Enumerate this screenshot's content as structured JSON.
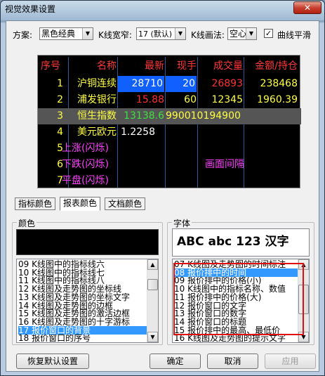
{
  "window": {
    "title": "视觉效果设置",
    "close_glyph": "✕"
  },
  "toolbar": {
    "scheme_label": "方案:",
    "scheme_value": "黑色经典",
    "kline_width_label": "K线宽窄:",
    "kline_width_value": "17 (默认)",
    "kline_draw_label": "K线画法:",
    "kline_draw_value": "空心",
    "smooth_label": "曲线平滑",
    "smooth_checked": "✓"
  },
  "preview": {
    "headers": [
      "序号",
      "名称",
      "最新",
      "现手",
      "成交量",
      "金额/持仓"
    ],
    "rows": [
      {
        "no": "1",
        "name": "沪铜连续",
        "latest": "28710",
        "hand": "20",
        "volume": "26893",
        "amount": "238468"
      },
      {
        "no": "2",
        "name": "浦发银行",
        "latest": "15.88",
        "hand": "60",
        "volume": "12345",
        "amount": "1960.39"
      },
      {
        "no": "3",
        "name": "恒生指数",
        "latest": "13138.6",
        "hand": "990010194900",
        "volume": "",
        "amount": ""
      },
      {
        "no": "4",
        "name": "美元欧元",
        "latest": "1.2258",
        "hand": "",
        "volume": "",
        "amount": ""
      },
      {
        "no": "5",
        "name": "上涨(闪烁)",
        "latest": "",
        "hand": "",
        "volume": "",
        "amount": ""
      },
      {
        "no": "6",
        "name": "下跌(闪烁)",
        "latest": "",
        "hand": "画面间隔",
        "volume": "",
        "amount": ""
      },
      {
        "no": "7",
        "name": "平盘(闪烁)",
        "latest": "",
        "hand": "",
        "volume": "",
        "amount": ""
      }
    ]
  },
  "tabs": [
    "指标颜色",
    "报表颜色",
    "文档颜色"
  ],
  "color_group": {
    "title": "颜色",
    "items": [
      "09 K线图中的指标线六",
      "10 K线图中的指标线七",
      "11 K线图中的指标线八",
      "12 K线图及走势图的坐标线",
      "13 K线图及走势图的坐标文字",
      "14 K线图及走势图的边框",
      "15 K线图及走势图的激活边框",
      "16 K线图及走势图的十字游标",
      "17 报价窗口的背景",
      "18 报价窗口的序号"
    ],
    "selected_index": 8
  },
  "font_group": {
    "title": "字体",
    "sample": "ABC abc 123 汉字",
    "items": [
      "07 K线图及走势图的时间标注",
      "08 报价排中的时间",
      "09 报价排中的价格(小)",
      "10 K线图中的指标名称、数值",
      "11 报价排中的价格(大)",
      "12 报价窗口的文字",
      "13 报价窗口的数字",
      "14 报价窗口的标题",
      "15 报价排中的最高、最低价",
      "16 K线图及走势图的提示文字"
    ],
    "selected_index": 1
  },
  "buttons": {
    "restore": "恢复默认设置",
    "ok": "确定",
    "cancel": "取消",
    "apply": "应用"
  },
  "colors": {
    "header_text": "#ff3838",
    "row_no": "#ffff40",
    "name_yellow": "#ffff40",
    "up_red": "#ff3030",
    "down_green": "#40e040",
    "white": "#ffffff",
    "magenta": "#ff40ff",
    "blue_hl": "#1060ff",
    "selected": "#3399ff",
    "red_box": "#e01010"
  }
}
